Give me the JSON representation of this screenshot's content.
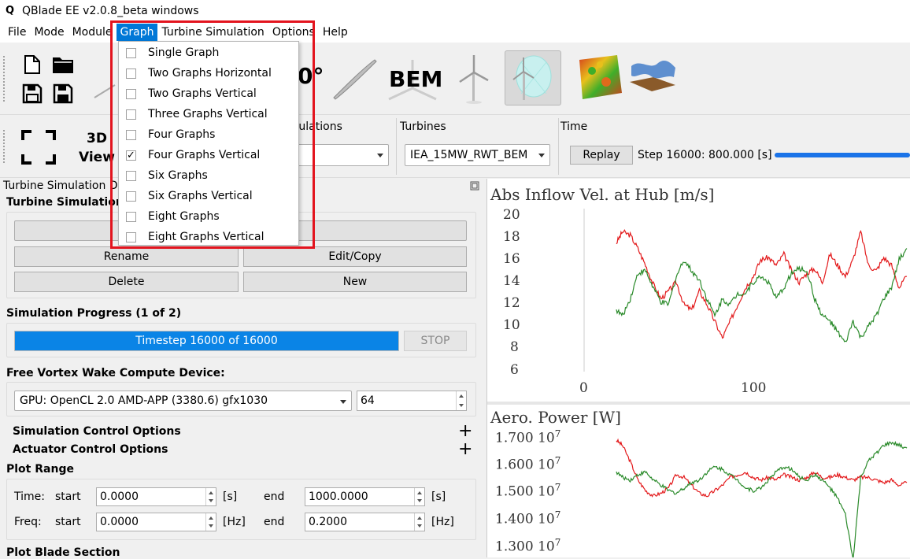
{
  "window": {
    "title": "QBlade EE v2.0.8_beta windows",
    "logo_glyph": "Q"
  },
  "menubar": {
    "items": [
      {
        "label": "File"
      },
      {
        "label": "Mode"
      },
      {
        "label": "Module"
      },
      {
        "label": "Graph",
        "active": true
      },
      {
        "label": "Turbine Simulation"
      },
      {
        "label": "Options"
      },
      {
        "label": "Help"
      }
    ]
  },
  "toolbar": {
    "bem_label": "BEM",
    "partial_label": "0°",
    "icons": [
      "new-file-icon",
      "open-folder-icon",
      "save-icon",
      "save-as-icon",
      "blade-icon",
      "bem-turbine-icon",
      "turbine-icon",
      "turbine-simulation-icon",
      "wind-field-icon",
      "terrain-surface-icon"
    ]
  },
  "toolbar2": {
    "view_label_line1": "3D",
    "view_label_line2": "View",
    "simulations_header": "Simulations",
    "turbines_header": "Turbines",
    "turbines_value": "IEA_15MW_RWT_BEM",
    "time_header": "Time",
    "replay_label": "Replay",
    "step_text": "Step 16000:",
    "time_value": "800.000 [s]"
  },
  "left": {
    "dock_title": "Turbine Simulation Definition",
    "section_title": "Turbine Simulation",
    "rename_label": "Rename",
    "editcopy_label": "Edit/Copy",
    "delete_label": "Delete",
    "new_label": "New",
    "progress_title": "Simulation Progress (1 of 2)",
    "progress_text": "Timestep 16000 of 16000",
    "progress_fraction": 1.0,
    "stop_label": "STOP",
    "device_title": "Free Vortex Wake Compute Device:",
    "device_value": "GPU: OpenCL 2.0 AMD-APP (3380.6) gfx1030",
    "device_count": "64",
    "sim_control": "Simulation Control Options",
    "act_control": "Actuator Control Options",
    "plus": "+",
    "plot_range_title": "Plot Range",
    "time_label": "Time:",
    "freq_label": "Freq:",
    "start_label": "start",
    "end_label": "end",
    "time_start": "0.0000",
    "time_end": "1000.0000",
    "time_unit": "[s]",
    "freq_start": "0.0000",
    "freq_end": "0.2000",
    "freq_unit": "[Hz]",
    "blade_section_title": "Plot Blade Section"
  },
  "graph_menu": {
    "items": [
      {
        "label": "Single Graph",
        "checked": false
      },
      {
        "label": "Two Graphs Horizontal",
        "checked": false
      },
      {
        "label": "Two Graphs Vertical",
        "checked": false
      },
      {
        "label": "Three Graphs Vertical",
        "checked": false
      },
      {
        "label": "Four Graphs",
        "checked": false
      },
      {
        "label": "Four Graphs Vertical",
        "checked": true
      },
      {
        "label": "Six Graphs",
        "checked": false
      },
      {
        "label": "Six Graphs Vertical",
        "checked": false
      },
      {
        "label": "Eight Graphs",
        "checked": false
      },
      {
        "label": "Eight Graphs Vertical",
        "checked": false
      }
    ],
    "check_glyph": "✓",
    "highlight_color": "#e3141e"
  },
  "chart_data": [
    {
      "type": "line",
      "title": "Abs Inflow Vel. at Hub [m/s]",
      "yticks": [
        "20",
        "18",
        "16",
        "14",
        "12",
        "10",
        "8",
        "6"
      ],
      "xticks": [
        "0",
        "100"
      ],
      "ylim": [
        6,
        20
      ],
      "series": [
        {
          "color": "#e31a1c",
          "x": [
            21,
            25,
            30,
            35,
            40,
            45,
            50,
            55,
            60,
            65,
            70,
            75,
            80,
            85,
            90,
            95,
            100,
            105,
            110,
            115,
            120,
            125,
            130,
            135,
            140,
            145,
            150,
            155,
            160,
            165,
            170,
            175,
            180,
            185,
            190,
            195,
            200,
            205,
            210
          ],
          "values": [
            17.5,
            18.5,
            18.2,
            17.0,
            15.5,
            13.8,
            12.5,
            13.2,
            14.0,
            12.0,
            11.5,
            13.2,
            12.0,
            10.5,
            9.0,
            10.5,
            12.0,
            13.5,
            14.5,
            16.0,
            16.2,
            15.5,
            16.5,
            15.0,
            14.0,
            14.8,
            15.2,
            14.0,
            16.5,
            15.5,
            14.5,
            16.0,
            18.5,
            15.5,
            15.0,
            16.2,
            15.5,
            13.5,
            14.5
          ]
        },
        {
          "color": "#2a8a2a",
          "x": [
            21,
            25,
            30,
            35,
            40,
            45,
            50,
            55,
            60,
            65,
            70,
            75,
            80,
            85,
            90,
            95,
            100,
            105,
            110,
            115,
            120,
            125,
            130,
            135,
            140,
            145,
            150,
            155,
            160,
            165,
            170,
            175,
            180,
            185,
            190,
            195,
            200,
            205,
            210
          ],
          "values": [
            11.5,
            11.0,
            12.5,
            14.8,
            15.0,
            13.5,
            12.2,
            12.0,
            14.5,
            16.0,
            15.0,
            14.2,
            12.5,
            11.0,
            12.5,
            12.0,
            13.0,
            13.0,
            14.0,
            14.5,
            14.0,
            12.5,
            13.5,
            14.8,
            15.2,
            15.0,
            12.5,
            11.0,
            10.5,
            9.5,
            8.5,
            10.5,
            9.0,
            10.0,
            11.0,
            12.5,
            13.5,
            16.0,
            17.0
          ]
        }
      ]
    },
    {
      "type": "line",
      "title": "Aero. Power [W]",
      "yticks": [
        "1.700 10",
        "1.600 10",
        "1.500 10",
        "1.400 10",
        "1.300 10"
      ],
      "ytick_exponent": "7",
      "ylim": [
        13000000.0,
        17000000.0
      ],
      "series": [
        {
          "color": "#e31a1c",
          "x": [
            21,
            25,
            30,
            35,
            40,
            45,
            50,
            55,
            60,
            65,
            70,
            75,
            80,
            85,
            90,
            95,
            100,
            105,
            110,
            115,
            120,
            125,
            130,
            135,
            140,
            145,
            150,
            155,
            160,
            165,
            170,
            175,
            180,
            185,
            190,
            195,
            200,
            205,
            210
          ],
          "values": [
            17000000.0,
            16800000.0,
            16200000.0,
            15500000.0,
            15100000.0,
            14900000.0,
            15000000.0,
            15200000.0,
            15700000.0,
            15600000.0,
            15300000.0,
            15000000.0,
            14900000.0,
            15100000.0,
            15300000.0,
            15600000.0,
            15700000.0,
            15800000.0,
            15600000.0,
            15500000.0,
            15600000.0,
            15500000.0,
            15700000.0,
            15600000.0,
            15500000.0,
            15600000.0,
            15800000.0,
            15600000.0,
            15600000.0,
            15700000.0,
            15600000.0,
            15500000.0,
            15600000.0,
            15600000.0,
            15500000.0,
            15400000.0,
            15500000.0,
            15300000.0,
            15400000.0
          ]
        },
        {
          "color": "#2a8a2a",
          "x": [
            21,
            25,
            30,
            35,
            40,
            45,
            50,
            55,
            60,
            65,
            70,
            75,
            80,
            85,
            90,
            95,
            100,
            105,
            110,
            115,
            120,
            125,
            130,
            135,
            140,
            145,
            150,
            155,
            160,
            165,
            170,
            175,
            180,
            185,
            190,
            195,
            200,
            205,
            210
          ],
          "values": [
            15800000.0,
            15600000.0,
            15500000.0,
            15700000.0,
            15800000.0,
            15500000.0,
            15300000.0,
            15100000.0,
            15000000.0,
            15200000.0,
            15400000.0,
            15500000.0,
            15800000.0,
            16000000.0,
            15900000.0,
            15700000.0,
            15500000.0,
            15200000.0,
            15100000.0,
            15200000.0,
            15500000.0,
            15800000.0,
            16000000.0,
            15900000.0,
            15600000.0,
            15500000.0,
            15700000.0,
            15500000.0,
            15200000.0,
            14800000.0,
            14200000.0,
            12500000.0,
            15600000.0,
            16200000.0,
            16500000.0,
            16800000.0,
            16900000.0,
            16800000.0,
            16700000.0
          ]
        }
      ]
    }
  ]
}
